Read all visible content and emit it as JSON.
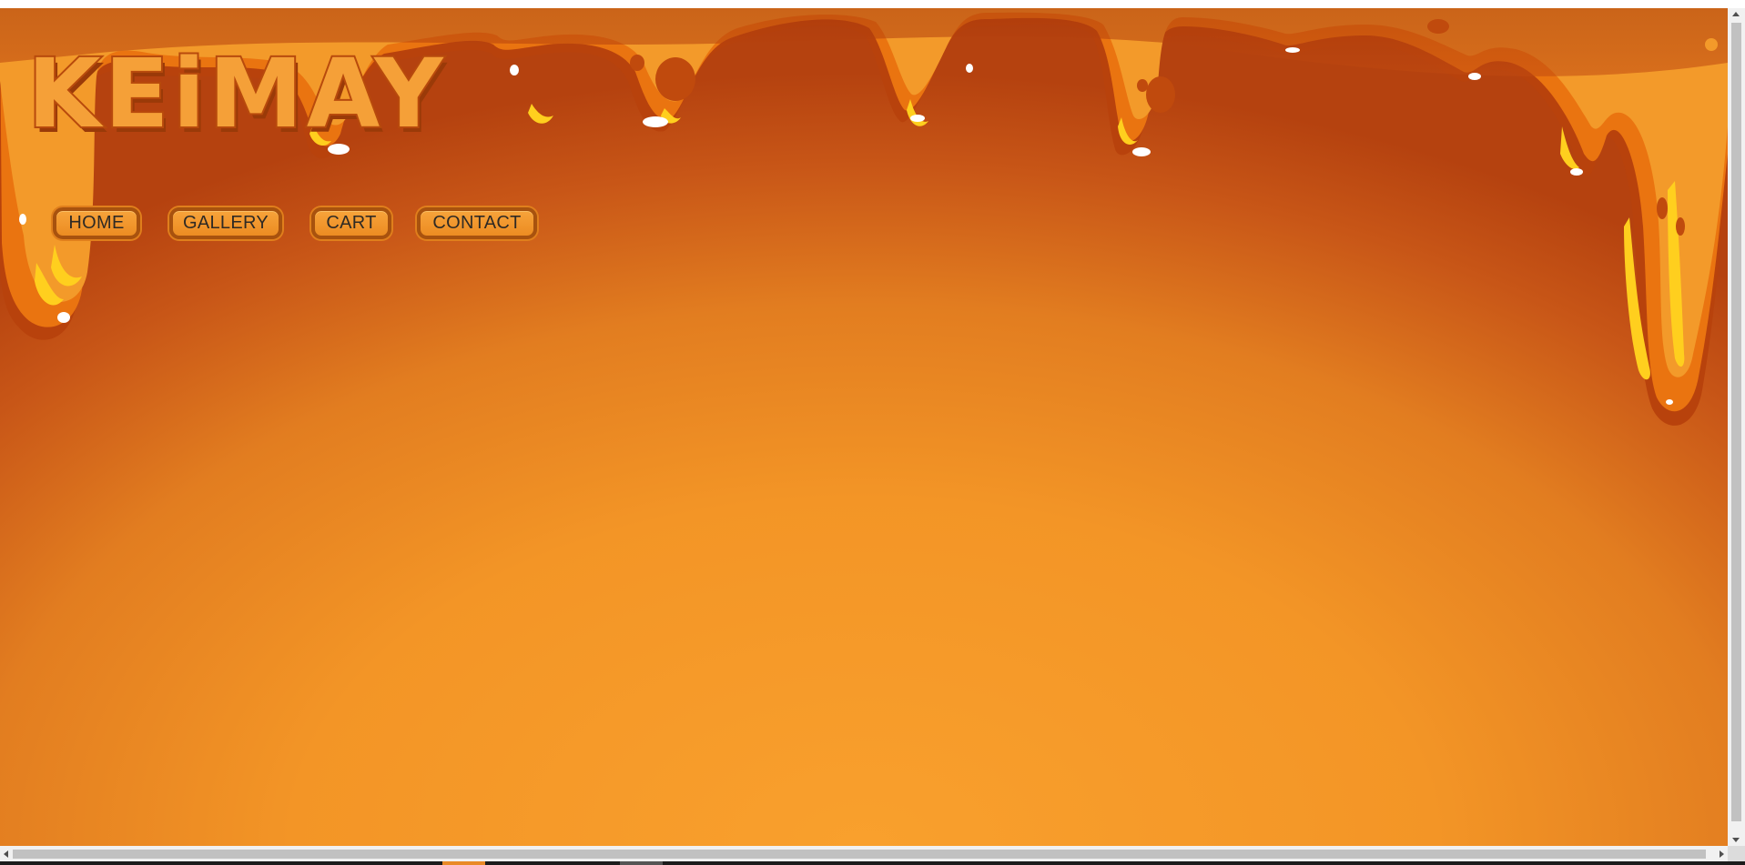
{
  "site": {
    "logo_text": "KEiMAY",
    "colors": {
      "background_center": "#f9a02d",
      "background_edge": "#b5420f",
      "drip_orange": "#f07d12",
      "drip_highlight": "#ffd21c",
      "nav_border": "#a8520e",
      "nav_text": "#2f2a24"
    }
  },
  "nav": {
    "items": [
      {
        "label": "HOME"
      },
      {
        "label": "GALLERY"
      },
      {
        "label": "CART"
      },
      {
        "label": "CONTACT"
      }
    ]
  },
  "browser": {
    "vertical_scrollbar": {
      "icon_up": "arrow-up-icon",
      "icon_down": "arrow-down-icon"
    },
    "horizontal_scrollbar": {
      "icon_left": "arrow-left-icon",
      "icon_right": "arrow-right-icon"
    }
  }
}
